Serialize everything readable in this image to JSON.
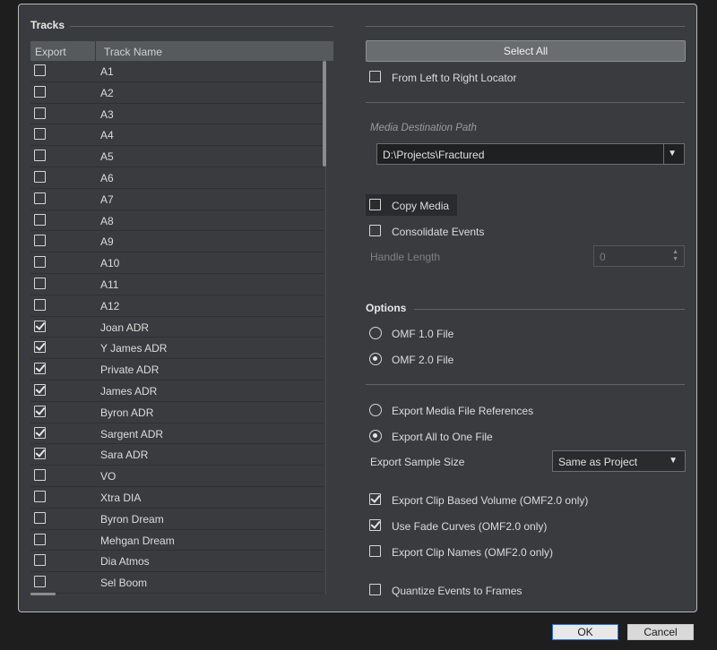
{
  "tracks_section": {
    "title": "Tracks",
    "col_export": "Export",
    "col_name": "Track Name",
    "rows": [
      {
        "name": "A1",
        "checked": false
      },
      {
        "name": "A2",
        "checked": false
      },
      {
        "name": "A3",
        "checked": false
      },
      {
        "name": "A4",
        "checked": false
      },
      {
        "name": "A5",
        "checked": false
      },
      {
        "name": "A6",
        "checked": false
      },
      {
        "name": "A7",
        "checked": false
      },
      {
        "name": "A8",
        "checked": false
      },
      {
        "name": "A9",
        "checked": false
      },
      {
        "name": "A10",
        "checked": false
      },
      {
        "name": "A11",
        "checked": false
      },
      {
        "name": "A12",
        "checked": false
      },
      {
        "name": "Joan ADR",
        "checked": true
      },
      {
        "name": "Y James ADR",
        "checked": true
      },
      {
        "name": "Private ADR",
        "checked": true
      },
      {
        "name": "James ADR",
        "checked": true
      },
      {
        "name": "Byron ADR",
        "checked": true
      },
      {
        "name": "Sargent ADR",
        "checked": true
      },
      {
        "name": "Sara ADR",
        "checked": true
      },
      {
        "name": "VO",
        "checked": false
      },
      {
        "name": "Xtra DIA",
        "checked": false
      },
      {
        "name": "Byron Dream",
        "checked": false
      },
      {
        "name": "Mehgan Dream",
        "checked": false
      },
      {
        "name": "Dia Atmos",
        "checked": false
      },
      {
        "name": "Sel Boom",
        "checked": false
      }
    ]
  },
  "right": {
    "select_all": "Select All",
    "from_left_to_right": {
      "label": "From Left to Right Locator",
      "checked": false
    },
    "media_destination_label": "Media Destination Path",
    "media_destination_value": "D:\\Projects\\Fractured",
    "copy_media": {
      "label": "Copy Media",
      "checked": false
    },
    "consolidate_events": {
      "label": "Consolidate Events",
      "checked": false
    },
    "handle_length_label": "Handle Length",
    "handle_length_value": "0",
    "options_title": "Options",
    "omf1": {
      "label": "OMF 1.0 File",
      "selected": false
    },
    "omf2": {
      "label": "OMF 2.0 File",
      "selected": true
    },
    "export_refs": {
      "label": "Export Media File References",
      "selected": false
    },
    "export_all": {
      "label": "Export All to One File",
      "selected": true
    },
    "sample_size_label": "Export Sample Size",
    "sample_size_value": "Same as Project",
    "clip_volume": {
      "label": "Export Clip Based Volume (OMF2.0 only)",
      "checked": true
    },
    "fade_curves": {
      "label": "Use Fade Curves (OMF2.0 only)",
      "checked": true
    },
    "clip_names": {
      "label": "Export Clip Names (OMF2.0 only)",
      "checked": false
    },
    "quantize": {
      "label": "Quantize Events to Frames",
      "checked": false
    }
  },
  "footer": {
    "ok": "OK",
    "cancel": "Cancel"
  },
  "icons": {
    "dropdown": "chevron-down-icon",
    "spin": "spinner-arrows-icon"
  }
}
